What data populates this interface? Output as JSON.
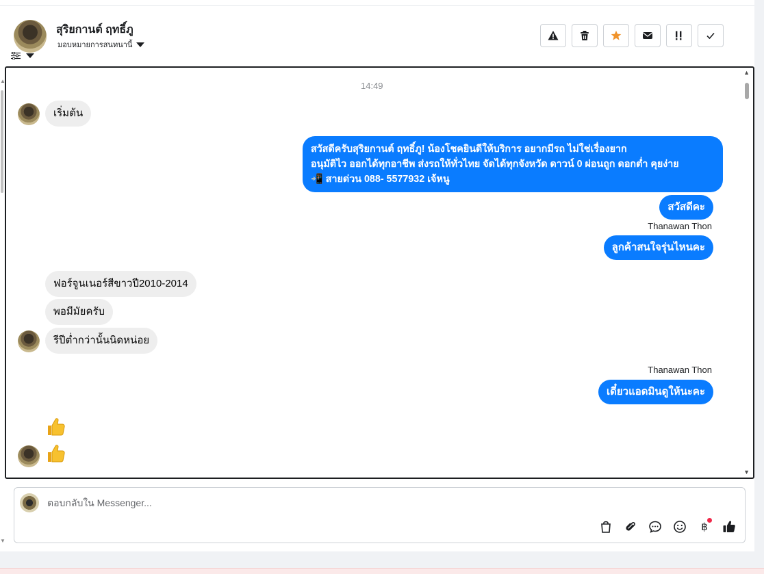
{
  "header": {
    "contact_name": "สุริยกานต์ ฤทธิ์ภู",
    "assign_label": "มอบหมายการสนทนานี้",
    "actions": [
      {
        "name": "warning-icon",
        "glyph": "!"
      },
      {
        "name": "trash-icon",
        "glyph": ""
      },
      {
        "name": "star-icon",
        "glyph": ""
      },
      {
        "name": "mail-icon",
        "glyph": ""
      },
      {
        "name": "important-icon",
        "glyph": "!!"
      },
      {
        "name": "check-icon",
        "glyph": ""
      }
    ]
  },
  "conversation": {
    "timestamp": "14:49",
    "messages": [
      {
        "id": "m1",
        "direction": "in",
        "text": "เริ่มต้น"
      },
      {
        "id": "m2",
        "direction": "out",
        "lines": [
          "สวัสดีครับสุริยกานต์ ฤทธิ์ภู! น้องโชคยินดีให้บริการ อยากมีรถ ไม่ใช่เรื่องยาก",
          "อนุมัติไว ออกได้ทุกอาชีพ ส่งรถให้ทั่วไทย จัดได้ทุกจังหวัด ดาวน์ 0  ผ่อนถูก ดอกต่ำ คุยง่าย",
          "📲 สายด่วน 088- 5577932 เจ้หนู"
        ]
      },
      {
        "id": "m3",
        "direction": "out",
        "text": "สวัสดีคะ"
      },
      {
        "id": "m4",
        "direction": "out",
        "sender": "Thanawan Thon",
        "text": "ลูกค้าสนใจรุ่นไหนคะ"
      },
      {
        "id": "m5",
        "direction": "in",
        "text": "ฟอร์จูนเนอร์สีขาวปี2010-2014"
      },
      {
        "id": "m6",
        "direction": "in",
        "text": "พอมีมัยครับ"
      },
      {
        "id": "m7",
        "direction": "in",
        "text": "รีปีต่ำกว่านั้นนิดหน่อย"
      },
      {
        "id": "m8",
        "direction": "out",
        "sender": "Thanawan Thon",
        "text": "เดี๋ยวแอดมินดูให้นะคะ"
      },
      {
        "id": "m9",
        "direction": "in",
        "emoji": "thumbs-up"
      },
      {
        "id": "m10",
        "direction": "in",
        "emoji": "thumbs-up"
      }
    ]
  },
  "composer": {
    "placeholder": "ตอบกลับใน Messenger...",
    "value": "",
    "baht_glyph": "฿",
    "tools": [
      "shopping-bag-icon",
      "paperclip-icon",
      "chat-bubble-icon",
      "smile-icon",
      "baht-icon",
      "like-icon"
    ]
  },
  "colors": {
    "outgoing_bubble": "#0a7cff",
    "incoming_bubble": "#eeeeee",
    "star": "#f0932b",
    "notification_dot": "#f02849"
  }
}
